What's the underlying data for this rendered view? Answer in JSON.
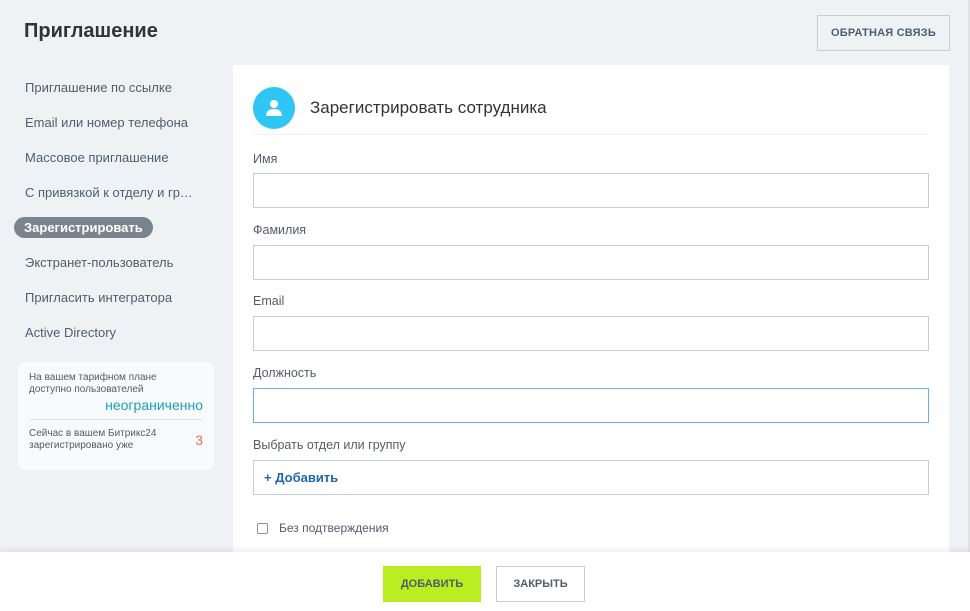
{
  "header": {
    "title": "Приглашение",
    "feedback_button": "ОБРАТНАЯ СВЯЗЬ"
  },
  "sidebar": {
    "items": [
      {
        "label": "Приглашение по ссылке",
        "active": false
      },
      {
        "label": "Email или номер телефона",
        "active": false
      },
      {
        "label": "Массовое приглашение",
        "active": false
      },
      {
        "label": "С привязкой к отделу и группе",
        "active": false
      },
      {
        "label": "Зарегистрировать",
        "active": true
      },
      {
        "label": "Экстранет-пользователь",
        "active": false
      },
      {
        "label": "Пригласить интегратора",
        "active": false
      },
      {
        "label": "Active Directory",
        "active": false
      }
    ]
  },
  "info_box": {
    "plan_text_line1": "На вашем тарифном плане",
    "plan_text_line2": "доступно пользователей",
    "plan_value": "неограниченно",
    "registered_text_line1": "Сейчас в вашем Битрикс24",
    "registered_text_line2": "зарегистрировано уже",
    "registered_value": "3"
  },
  "form": {
    "title": "Зарегистрировать сотрудника",
    "avatar_icon": "user-icon",
    "fields": {
      "first_name": {
        "label": "Имя",
        "value": ""
      },
      "last_name": {
        "label": "Фамилия",
        "value": ""
      },
      "email": {
        "label": "Email",
        "value": ""
      },
      "position": {
        "label": "Должность",
        "value": ""
      },
      "department": {
        "label": "Выбрать отдел или группу",
        "add_label": "+ Добавить"
      }
    },
    "no_confirmation": {
      "label": "Без подтверждения",
      "checked": false
    }
  },
  "footer": {
    "add_button": "ДОБАВИТЬ",
    "close_button": "ЗАКРЫТЬ"
  },
  "colors": {
    "accent_green": "#bbed21",
    "avatar_blue": "#2fc6f6",
    "link_blue": "#2067b0",
    "value_blue": "#1a9ec2",
    "value_red": "#e56c5c",
    "active_pill": "#7b838f"
  }
}
